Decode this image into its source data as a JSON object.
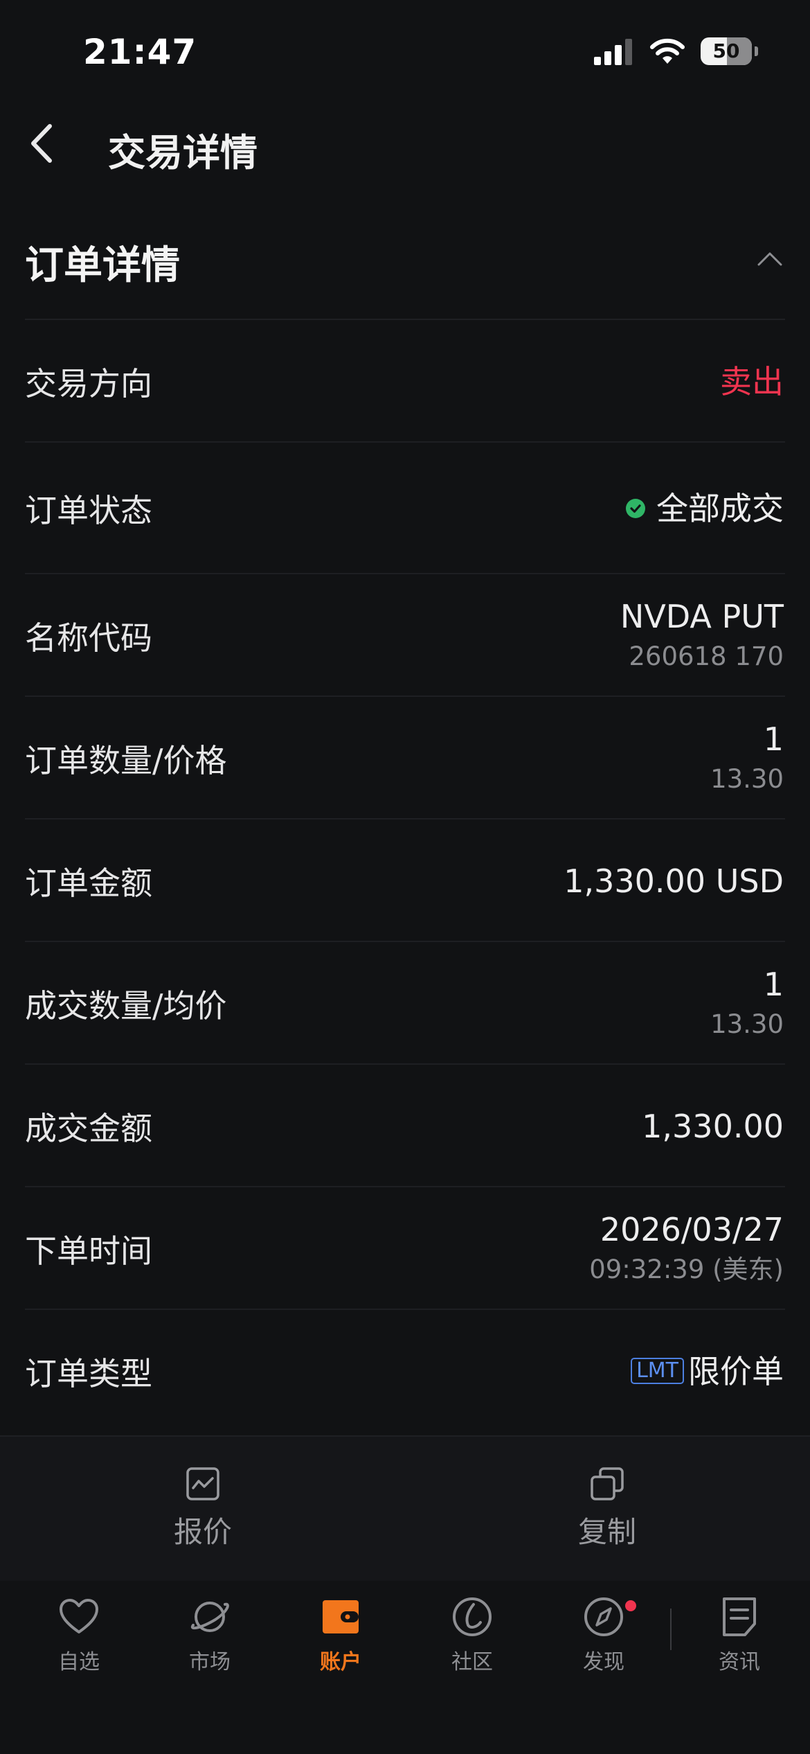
{
  "status_bar": {
    "time": "21:47",
    "battery": "50"
  },
  "header": {
    "title": "交易详情"
  },
  "section": {
    "title": "订单详情"
  },
  "rows": [
    {
      "label": "交易方向",
      "value": "卖出"
    },
    {
      "label": "订单状态",
      "value": "全部成交"
    },
    {
      "label": "名称代码",
      "value": "NVDA PUT",
      "sub": "260618 170"
    },
    {
      "label": "订单数量/价格",
      "value": "1",
      "sub": "13.30"
    },
    {
      "label": "订单金额",
      "value": "1,330.00 USD"
    },
    {
      "label": "成交数量/均价",
      "value": "1",
      "sub": "13.30"
    },
    {
      "label": "成交金额",
      "value": "1,330.00"
    },
    {
      "label": "下单时间",
      "value": "2026/03/27",
      "sub": "09:32:39 (美东)"
    },
    {
      "label": "订单类型",
      "badge": "LMT",
      "value": "限价单"
    }
  ],
  "actions": {
    "quote": "报价",
    "copy": "复制"
  },
  "tabs": [
    "自选",
    "市场",
    "账户",
    "社区",
    "发现",
    "资讯"
  ],
  "colors": {
    "sell": "#f0344f",
    "success": "#2fb566",
    "accent": "#f2761c",
    "badge": "#4c7fe0"
  }
}
